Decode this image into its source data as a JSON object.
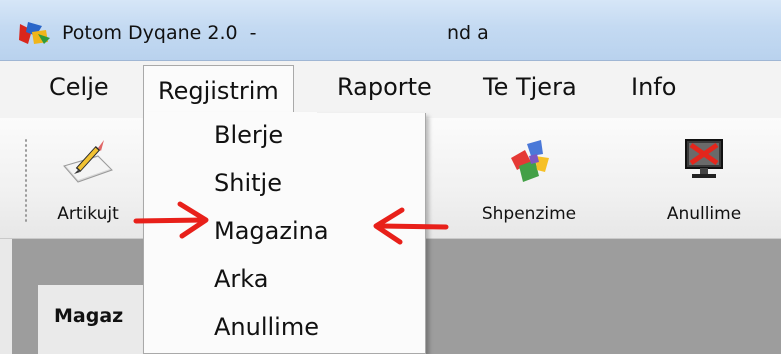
{
  "window": {
    "title": "Potom Dyqane 2.0  -",
    "title_suffix": "nd a"
  },
  "menubar": {
    "items": [
      "Celje",
      "Regjistrim",
      "Raporte",
      "Te Tjera",
      "Info"
    ],
    "active_index": 1
  },
  "toolbar": {
    "items": [
      {
        "label": "Artikujt",
        "icon": "pencil-paper-icon"
      },
      {
        "label": "Shpenzime",
        "icon": "colored-blocks-icon"
      },
      {
        "label": "Anullime",
        "icon": "monitor-x-icon"
      }
    ]
  },
  "dropdown": {
    "items": [
      "Blerje",
      "Shitje",
      "Magazina",
      "Arka",
      "Anullime"
    ],
    "highlighted_item": "Magazina"
  },
  "content": {
    "form_title": "Magaz"
  },
  "colors": {
    "titlebar": "#c4daf2",
    "menubar": "#f3f3f3",
    "content_bg": "#9d9d9d",
    "arrow_red": "#e8201a"
  }
}
